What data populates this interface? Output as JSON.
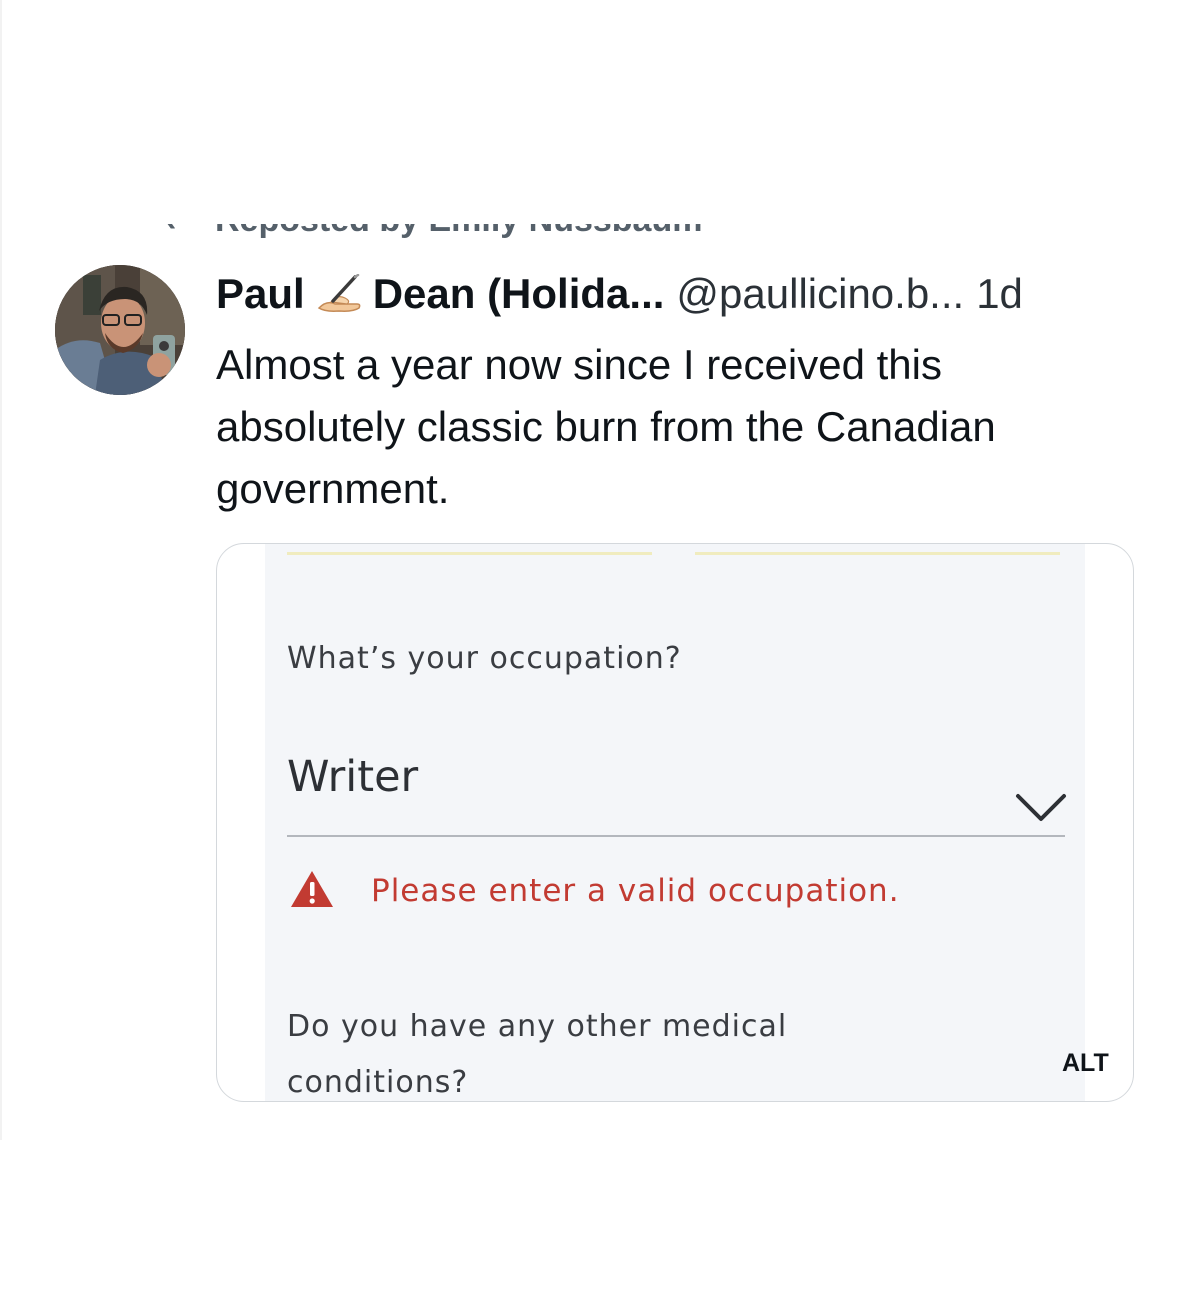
{
  "post": {
    "repost_line": "Reposted by Emily Nussbaum",
    "author": {
      "display_name_first": "Paul",
      "display_name_rest": "Dean (Holida...",
      "handle": "@paullicino.b...",
      "separator": "",
      "timestamp": "1d",
      "name_icon": "writing-hand-icon"
    },
    "text": "Almost a year now since I received this absolutely classic burn from the Canadian government.",
    "media": {
      "alt_badge": "ALT",
      "form": {
        "question_1": "What’s your occupation?",
        "answer_1": "Writer",
        "error_message": "Please enter a valid occupation.",
        "question_2": "Do you have any other medical conditions?"
      }
    }
  },
  "colors": {
    "error": "#c23b32",
    "text_primary": "#0f1419",
    "form_background": "#f4f6f9"
  }
}
